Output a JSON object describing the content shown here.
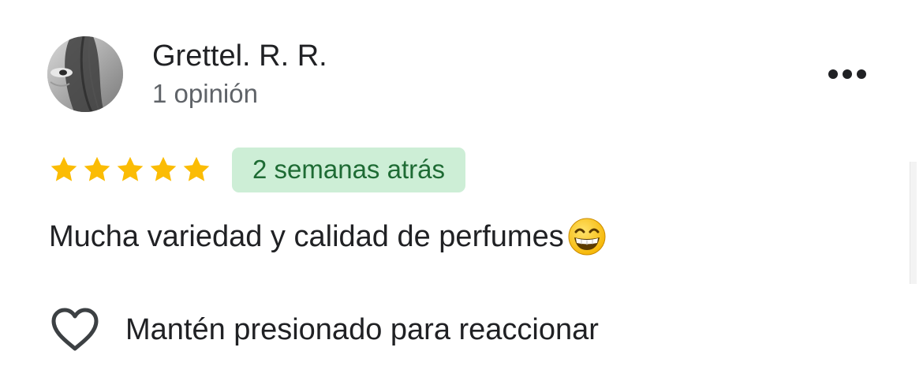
{
  "reviewer": {
    "name": "Grettel. R. R.",
    "review_count": "1 opinión"
  },
  "rating": {
    "stars": 5,
    "max_stars": 5,
    "star_color": "#fbbc04"
  },
  "time_badge": {
    "text": "2 semanas atrás",
    "background": "#cdeed6",
    "color": "#1e6b34"
  },
  "review": {
    "text": "Mucha variedad y calidad de perfumes",
    "emoji_name": "grinning-face-with-smiling-eyes"
  },
  "reaction": {
    "label": "Mantén presionado para reaccionar",
    "icon": "heart-outline-icon"
  },
  "menu": {
    "icon": "more-horizontal-icon"
  }
}
